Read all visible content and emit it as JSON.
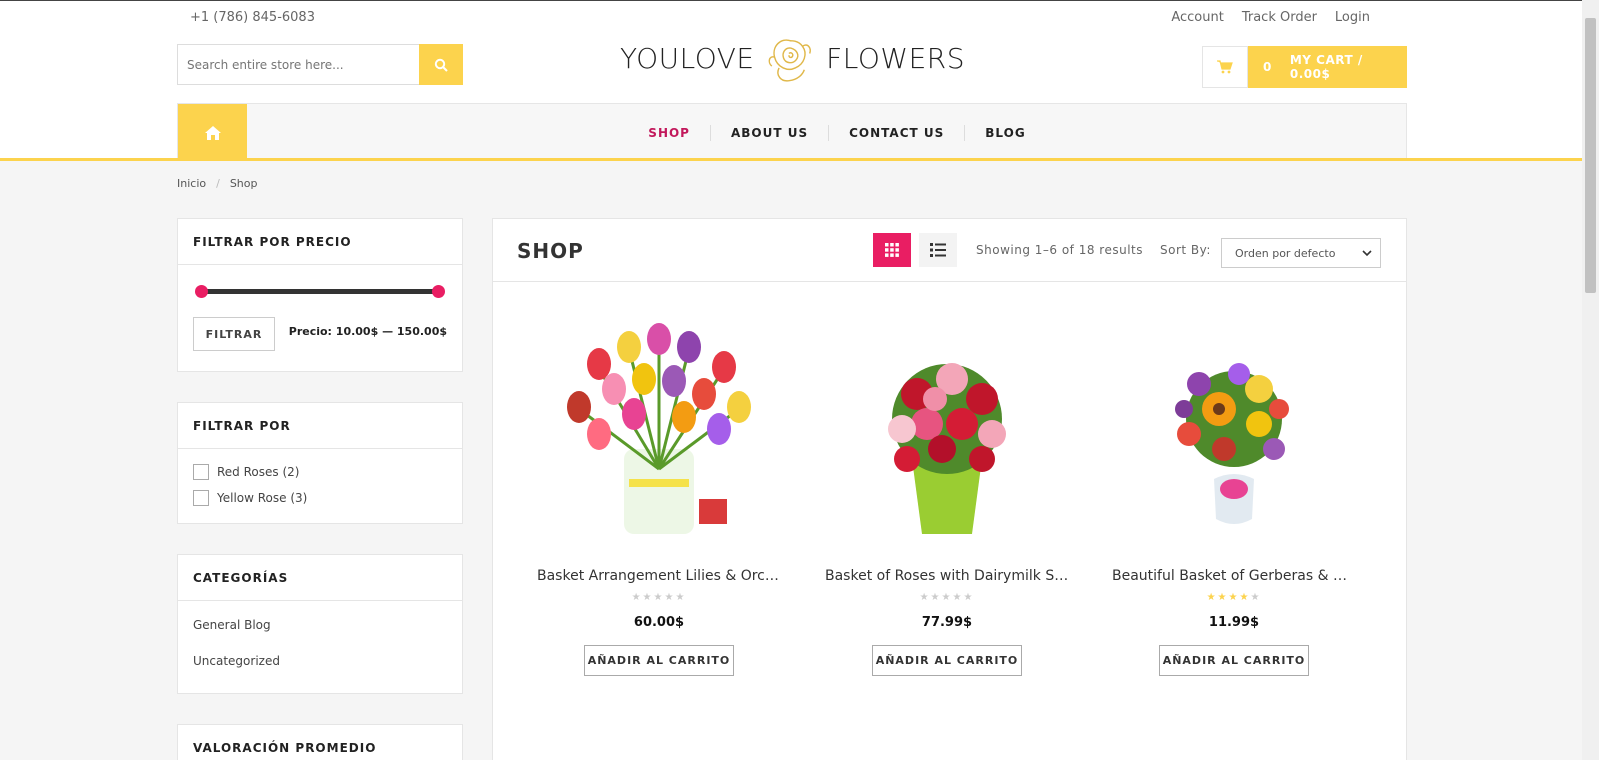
{
  "header": {
    "phone": "+1 (786) 845-6083",
    "links": [
      "Account",
      "Track Order",
      "Login"
    ],
    "search_placeholder": "Search entire store here...",
    "logo_left": "YOULOVE",
    "logo_right": "FLOWERS",
    "cart_count": "0",
    "cart_label": "MY CART / 0.00$"
  },
  "nav": {
    "items": [
      "SHOP",
      "ABOUT US",
      "CONTACT US",
      "BLOG"
    ],
    "active": "SHOP"
  },
  "breadcrumb": {
    "home": "Inicio",
    "sep": "/",
    "current": "Shop"
  },
  "sidebar": {
    "price_filter": {
      "title": "FILTRAR POR PRECIO",
      "button": "FILTRAR",
      "range_text": "Precio: 10.00$ — 150.00$"
    },
    "filter_by": {
      "title": "FILTRAR POR",
      "options": [
        "Red Roses (2)",
        "Yellow Rose (3)"
      ]
    },
    "categories": {
      "title": "CATEGORÍAS",
      "items": [
        "General Blog",
        "Uncategorized"
      ]
    },
    "rating": {
      "title": "VALORACIÓN PROMEDIO"
    }
  },
  "main": {
    "title": "SHOP",
    "showing": "Showing 1–6 of 18 results",
    "sort_label": "Sort By:",
    "sort_value": "Orden por defecto",
    "products": [
      {
        "name": "Basket Arrangement Lilies & Orch...",
        "price": "60.00$",
        "rating": 0,
        "button": "AÑADIR AL CARRITO"
      },
      {
        "name": "Basket of Roses with Dairymilk Silk",
        "price": "77.99$",
        "rating": 0,
        "button": "AÑADIR AL CARRITO"
      },
      {
        "name": "Beautiful Basket of Gerberas & Ro...",
        "price": "11.99$",
        "rating": 4,
        "button": "AÑADIR AL CARRITO"
      }
    ]
  },
  "colors": {
    "accent_yellow": "#fcd34d",
    "accent_pink": "#e91e63"
  }
}
